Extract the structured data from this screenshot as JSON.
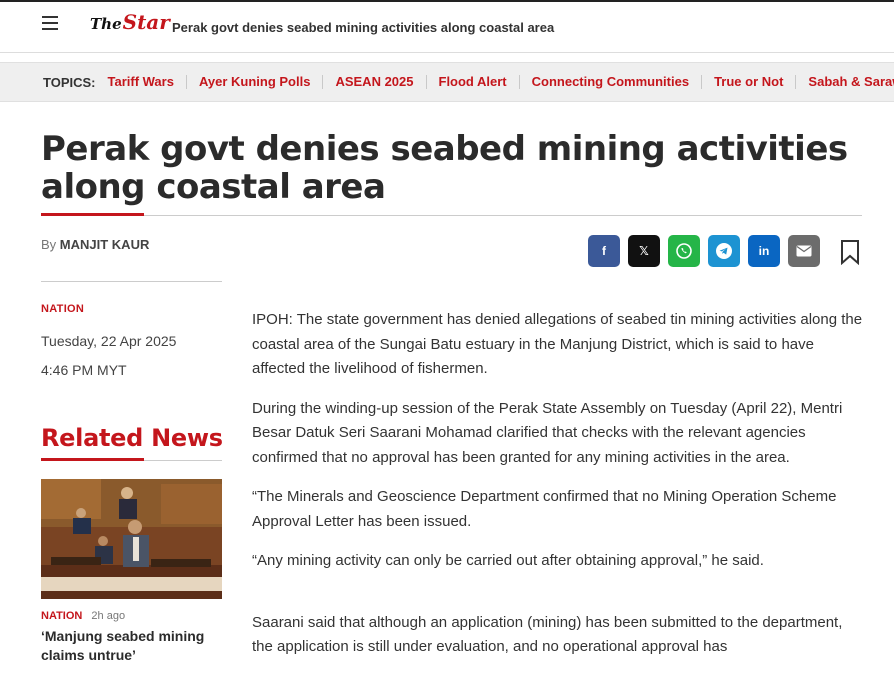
{
  "header": {
    "logo_the": "The",
    "logo_star": "Star",
    "title": "Perak govt denies seabed mining activities along coastal area"
  },
  "topics": {
    "label": "TOPICS:",
    "items": [
      "Tariff Wars",
      "Ayer Kuning Polls",
      "ASEAN 2025",
      "Flood Alert",
      "Connecting Communities",
      "True or Not",
      "Sabah & Sarawak"
    ]
  },
  "article": {
    "headline": "Perak govt denies seabed mining activities along coastal area",
    "byline_prefix": "By",
    "author": "MANJIT KAUR",
    "section": "NATION",
    "date": "Tuesday, 22 Apr 2025",
    "time": "4:46 PM MYT",
    "paragraphs": [
      "IPOH: The state government has denied allegations of seabed tin mining activities along the coastal area of the Sungai Batu estuary in the Manjung District, which is said to have affected the livelihood of fishermen.",
      "During the winding-up session of the Perak State Assembly on Tuesday (April 22), Mentri Besar Datuk Seri Saarani Mohamad clarified that checks with the relevant agencies confirmed that no approval has been granted for any mining activities in the area.",
      "“The Minerals and Geoscience Department confirmed that no Mining Operation Scheme Approval Letter has been issued.",
      "“Any mining activity can only be carried out after obtaining approval,” he said.",
      "Saarani said that although an application (mining) has been submitted to the department, the application is still under evaluation, and no operational approval has"
    ]
  },
  "share": {
    "icons": [
      "facebook-icon",
      "x-icon",
      "whatsapp-icon",
      "telegram-icon",
      "linkedin-icon",
      "email-icon"
    ],
    "facebook_glyph": "f",
    "x_glyph": "𝕏",
    "linkedin_glyph": "in"
  },
  "related": {
    "title": "Related News",
    "items": [
      {
        "category": "NATION",
        "ago": "2h ago",
        "headline": "‘Manjung seabed mining claims untrue’"
      }
    ]
  },
  "colors": {
    "brand_red": "#c4161c",
    "facebook": "#3b5998",
    "x": "#111111",
    "whatsapp": "#25b548",
    "telegram": "#1d93d2",
    "linkedin": "#0a66c2",
    "email": "#6c6c6c"
  }
}
